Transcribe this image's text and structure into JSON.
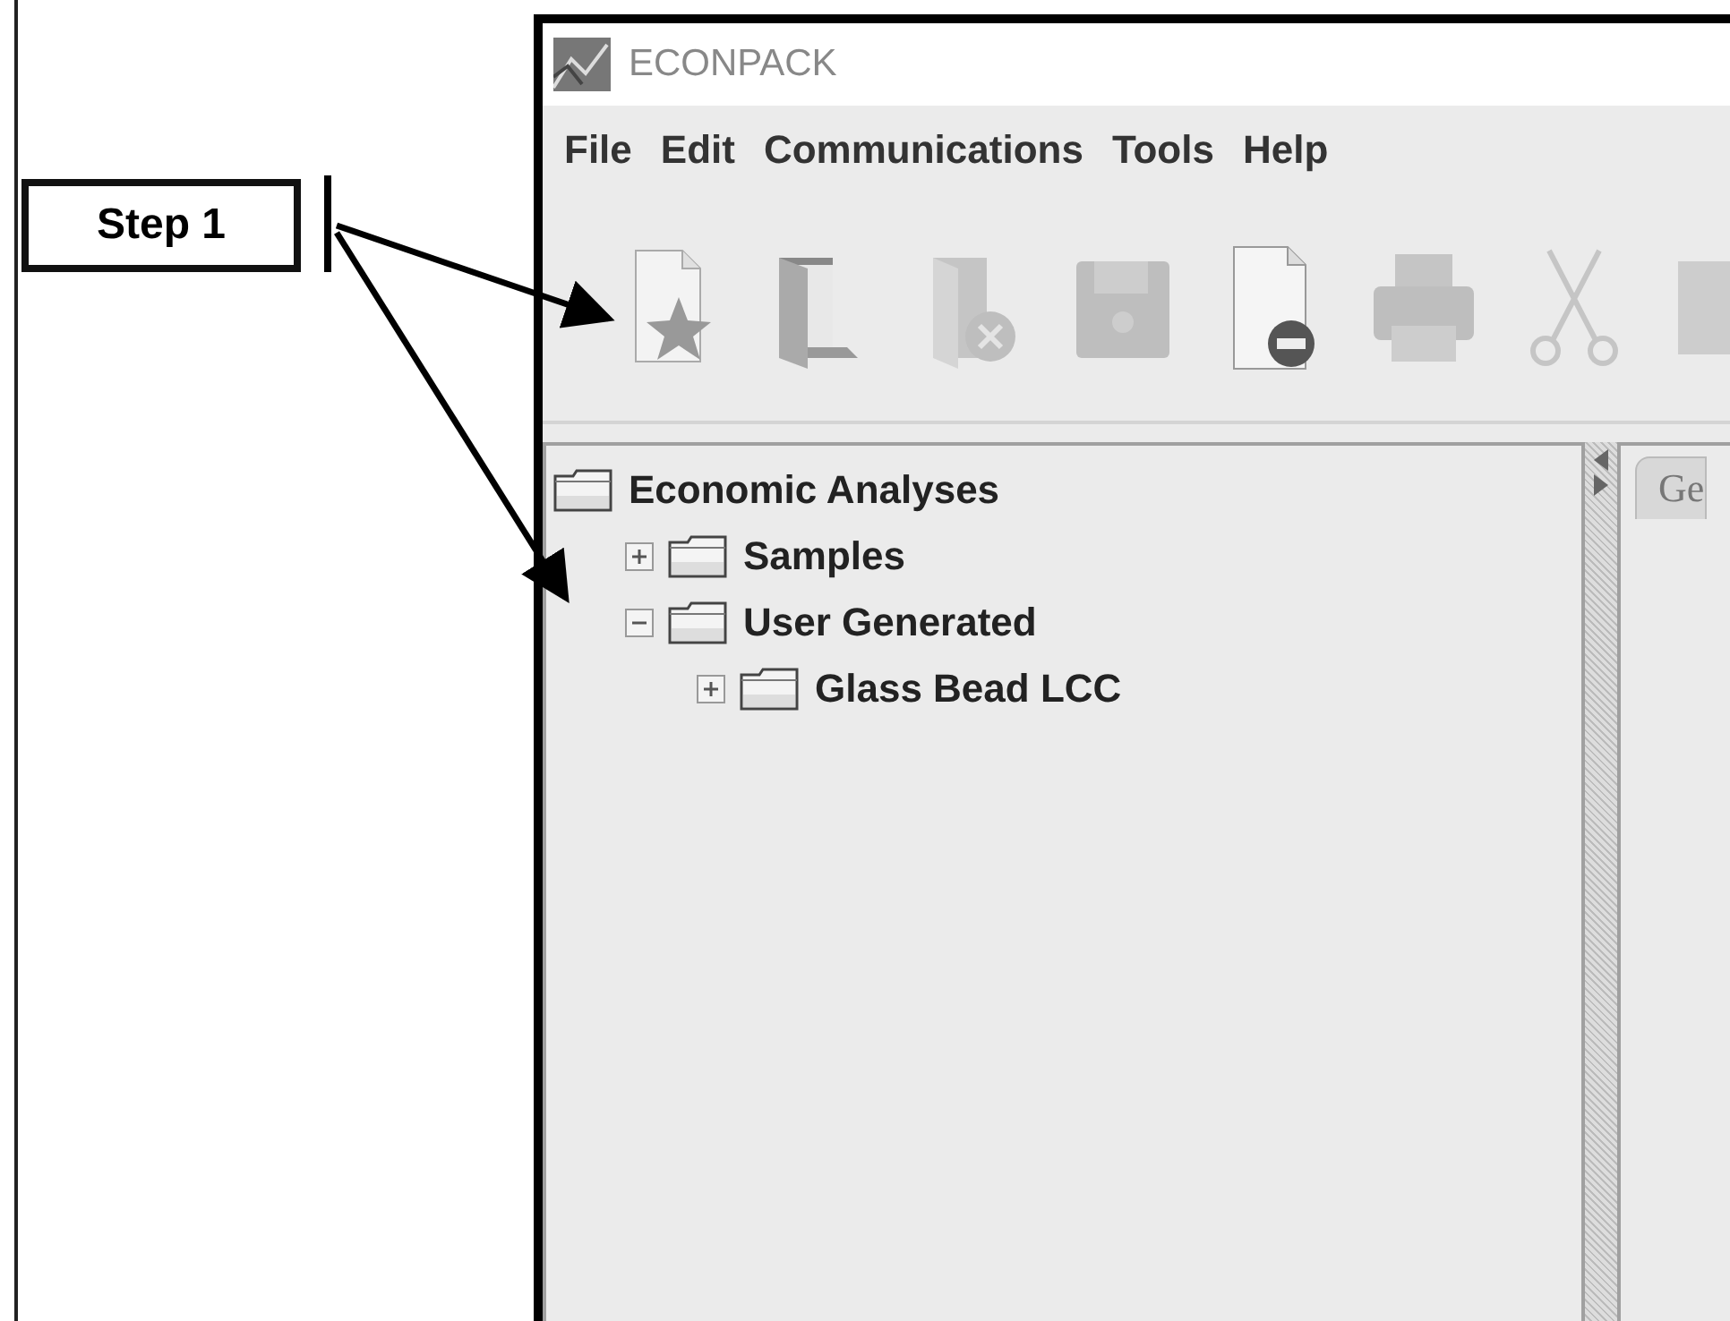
{
  "callout": {
    "label": "Step 1"
  },
  "window": {
    "title": "ECONPACK"
  },
  "menu": [
    "File",
    "Edit",
    "Communications",
    "Tools",
    "Help"
  ],
  "toolbar": [
    {
      "kind": "new",
      "disabled": false
    },
    {
      "kind": "open",
      "disabled": false
    },
    {
      "kind": "close",
      "disabled": true
    },
    {
      "kind": "save",
      "disabled": true
    },
    {
      "kind": "remove",
      "disabled": false
    },
    {
      "kind": "print",
      "disabled": true
    },
    {
      "kind": "cut",
      "disabled": true
    },
    {
      "kind": "blank",
      "disabled": true
    }
  ],
  "tree": {
    "label": "Economic Analyses",
    "children": [
      {
        "label": "Samples",
        "expanded": false
      },
      {
        "label": "User Generated",
        "expanded": true,
        "children": [
          {
            "label": "Glass Bead LCC",
            "expanded": false
          }
        ]
      }
    ]
  },
  "right_panel": {
    "tabs": [
      {
        "label": "Ge"
      }
    ]
  }
}
